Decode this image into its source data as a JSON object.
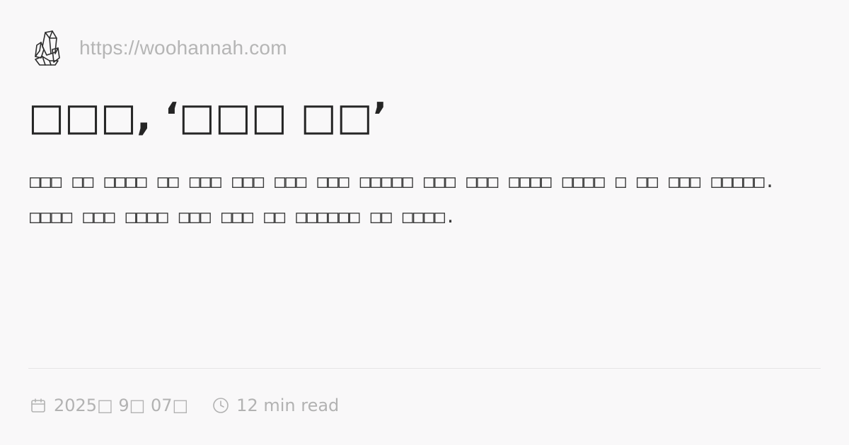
{
  "site": {
    "logo_icon": "crystal-icon",
    "url": "https://woohannah.com"
  },
  "post": {
    "title": "□□□, ‘□□□ □□’",
    "description": "□□□ □□ □□□□ □□ □□□ □□□ □□□ □□□ □□□□□ □□□ □□□ □□□□ □□□□ □ □□ □□□ □□□□□. □□□□ □□□ □□□□ □□□ □□□ □□ □□□□□□ □□ □□□□.",
    "date": "2025□ 9□ 07□",
    "read_time": "12 min read",
    "date_icon": "calendar-icon",
    "read_time_icon": "clock-icon"
  }
}
